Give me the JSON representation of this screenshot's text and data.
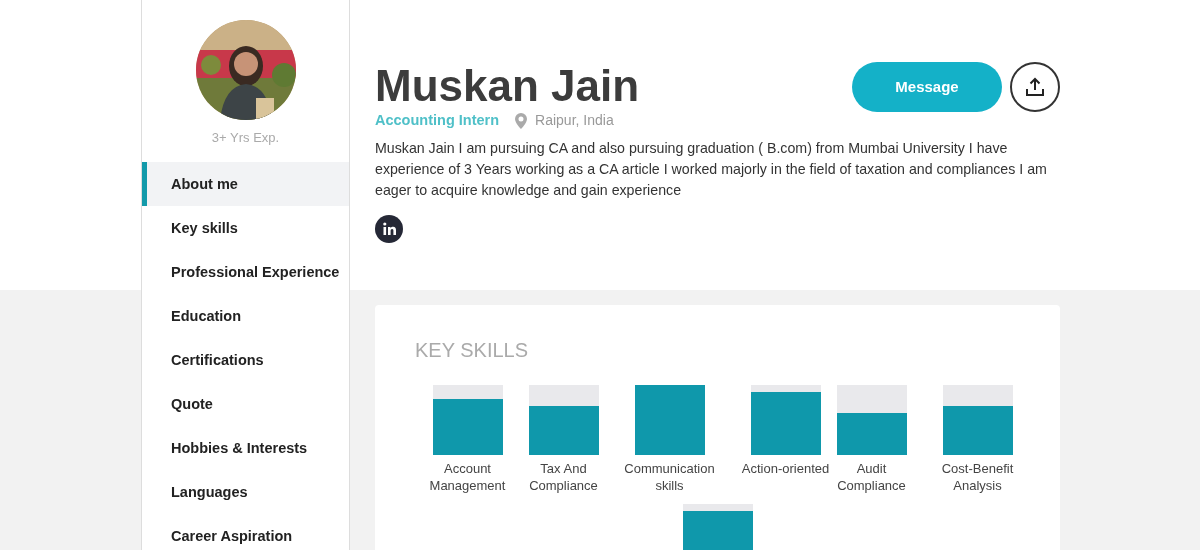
{
  "profile": {
    "experience": "3+ Yrs Exp.",
    "name": "Muskan Jain",
    "role": "Accounting Intern",
    "location": "Raipur, India",
    "bio": "Muskan Jain I am pursuing CA and also pursuing graduation ( B.com) from Mumbai University I have experience of 3 Years working as a CA article I worked majorly in the field of taxation and compliances I am eager to acquire knowledge and gain experience"
  },
  "actions": {
    "message": "Message"
  },
  "sidebar": {
    "items": [
      {
        "label": "About me",
        "selected": true
      },
      {
        "label": "Key skills",
        "selected": false
      },
      {
        "label": "Professional Experience",
        "selected": false
      },
      {
        "label": "Education",
        "selected": false
      },
      {
        "label": "Certifications",
        "selected": false
      },
      {
        "label": "Quote",
        "selected": false
      },
      {
        "label": "Hobbies & Interests",
        "selected": false
      },
      {
        "label": "Languages",
        "selected": false
      },
      {
        "label": "Career Aspiration",
        "selected": false
      }
    ]
  },
  "key_skills": {
    "title": "KEY SKILLS",
    "skills": [
      {
        "kind": "meter",
        "name": "Account Management"
      },
      {
        "kind": "meter",
        "name": "Tax And Compliance"
      },
      {
        "kind": "meter",
        "name": "Communication skills"
      },
      {
        "kind": "meter",
        "name": "Action-oriented"
      },
      {
        "kind": "meter",
        "name": "Audit Compliance"
      },
      {
        "kind": "meter",
        "name": "Cost-Benefit Analysis"
      },
      {
        "kind": "meter"
      }
    ]
  }
}
